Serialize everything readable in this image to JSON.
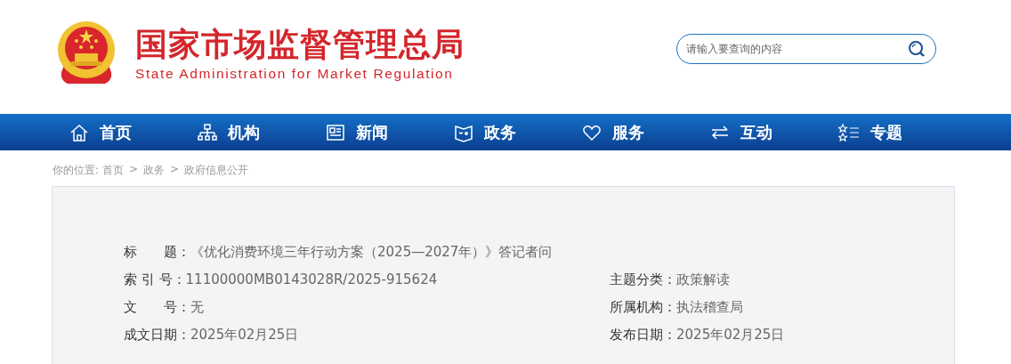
{
  "header": {
    "title": "国家市场监督管理总局",
    "subtitle": "State Administration for Market Regulation"
  },
  "search": {
    "placeholder": "请输入要查询的内容"
  },
  "nav": [
    {
      "label": "首页",
      "kind": "home"
    },
    {
      "label": "机构",
      "kind": "org"
    },
    {
      "label": "新闻",
      "kind": "news"
    },
    {
      "label": "政务",
      "kind": "gov"
    },
    {
      "label": "服务",
      "kind": "service"
    },
    {
      "label": "互动",
      "kind": "interact"
    },
    {
      "label": "专题",
      "kind": "topic"
    }
  ],
  "breadcrumb": {
    "prefix": "你的位置:",
    "items": [
      "首页",
      "政务",
      "政府信息公开"
    ],
    "separator": ">"
  },
  "info": {
    "title": {
      "label": "标　　题：",
      "value": "《优化消费环境三年行动方案（2025—2027年）》答记者问"
    },
    "rows": [
      [
        {
          "label": "索 引 号：",
          "value": "11100000MB0143028R/2025-915624"
        },
        {
          "label": "主题分类：",
          "value": "政策解读"
        }
      ],
      [
        {
          "label": "文　　号：",
          "value": "无"
        },
        {
          "label": "所属机构：",
          "value": "执法稽查局"
        }
      ],
      [
        {
          "label": "成文日期：",
          "value": "2025年02月25日"
        },
        {
          "label": "发布日期：",
          "value": "2025年02月25日"
        }
      ]
    ]
  }
}
